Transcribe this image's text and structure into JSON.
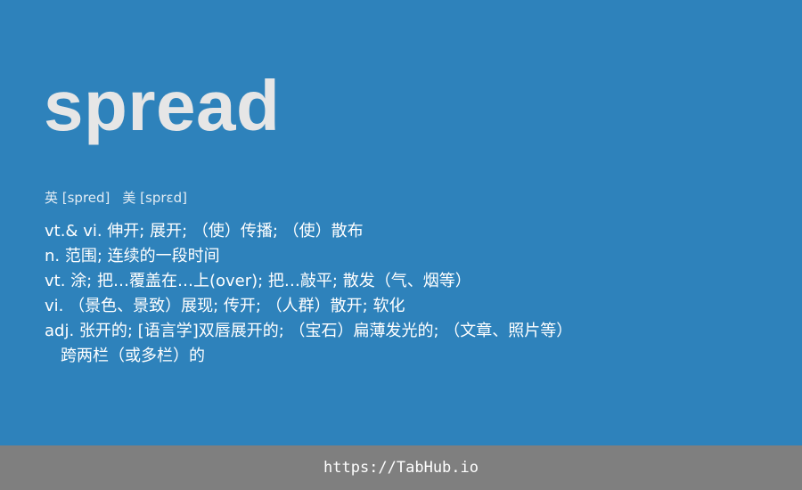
{
  "entry": {
    "word": "spread",
    "phonetics": {
      "uk": "英 [spred]",
      "us": "美 [sprɛd]"
    },
    "definitions": [
      "vt.& vi. 伸开; 展开; （使）传播; （使）散布",
      "n. 范围; 连续的一段时间",
      "vt. 涂; 把…覆盖在…上(over); 把…敲平; 散发（气、烟等）",
      "vi. （景色、景致）展现; 传开; （人群）散开; 软化",
      "adj. 张开的; [语言学]双唇展开的; （宝石）扁薄发光的; （文章、照片等）",
      "跨两栏（或多栏）的"
    ]
  },
  "footer": {
    "link_text": "https://TabHub.io"
  }
}
